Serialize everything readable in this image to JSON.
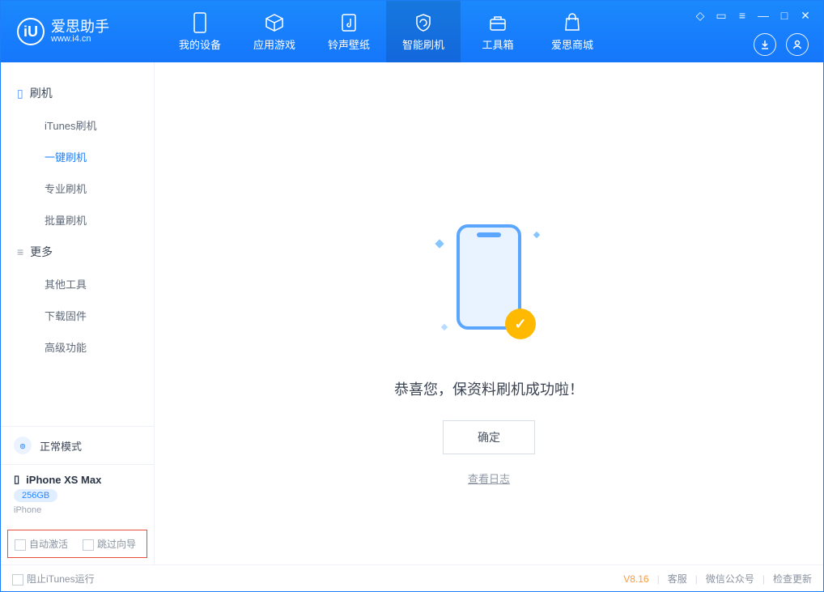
{
  "app": {
    "title": "爱思助手",
    "subtitle": "www.i4.cn"
  },
  "tabs": {
    "device": "我的设备",
    "apps": "应用游戏",
    "ringtone": "铃声壁纸",
    "flash": "智能刷机",
    "toolbox": "工具箱",
    "store": "爱思商城"
  },
  "sidebar": {
    "group_flash": "刷机",
    "items_flash": {
      "itunes": "iTunes刷机",
      "oneclick": "一键刷机",
      "pro": "专业刷机",
      "batch": "批量刷机"
    },
    "group_more": "更多",
    "items_more": {
      "other": "其他工具",
      "firmware": "下载固件",
      "advanced": "高级功能"
    },
    "mode": "正常模式",
    "device": {
      "name": "iPhone XS Max",
      "storage": "256GB",
      "type": "iPhone"
    },
    "auto_activate": "自动激活",
    "skip_guide": "跳过向导"
  },
  "main": {
    "success_text": "恭喜您，保资料刷机成功啦！",
    "ok": "确定",
    "view_log": "查看日志"
  },
  "footer": {
    "block_itunes": "阻止iTunes运行",
    "version": "V8.16",
    "support": "客服",
    "wechat": "微信公众号",
    "update": "检查更新"
  }
}
